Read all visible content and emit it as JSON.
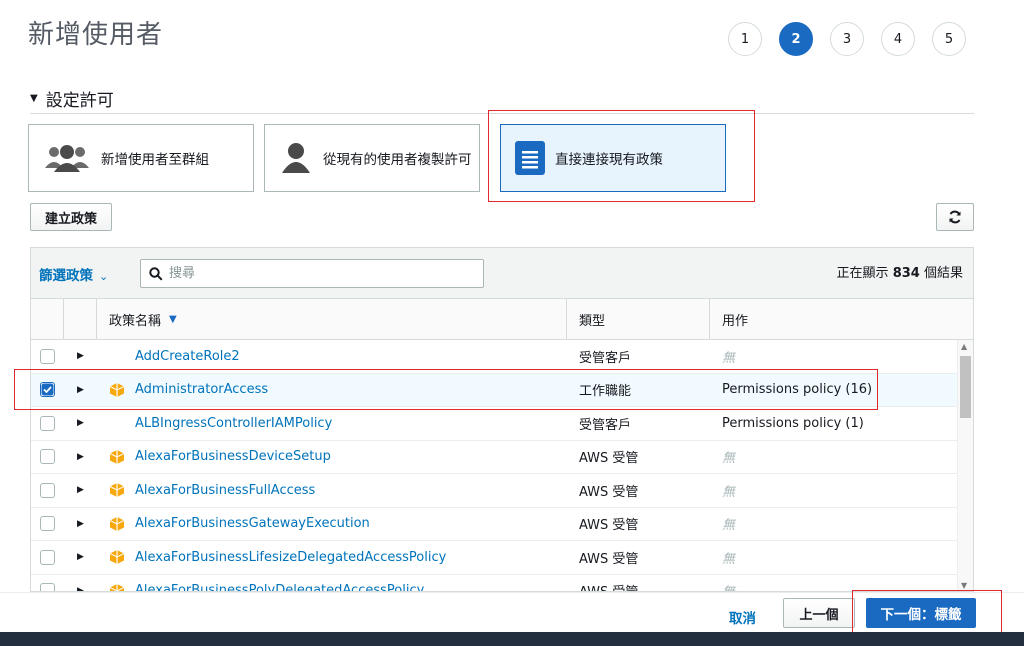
{
  "page": {
    "title": "新增使用者"
  },
  "steps": [
    "1",
    "2",
    "3",
    "4",
    "5"
  ],
  "active_step": "2",
  "section": {
    "title": "設定許可"
  },
  "options": [
    {
      "label": "新增使用者至群組",
      "icon": "users-group-icon"
    },
    {
      "label": "從現有的使用者複製許可",
      "icon": "user-icon"
    },
    {
      "label": "直接連接現有政策",
      "icon": "document-icon"
    }
  ],
  "buttons": {
    "create_policy": "建立政策",
    "refresh": "refresh-icon"
  },
  "table": {
    "filter_label": "篩選政策",
    "search_placeholder": "搜尋",
    "result_prefix": "正在顯示",
    "result_count": "834",
    "result_suffix": "個結果",
    "columns": {
      "name": "政策名稱",
      "type": "類型",
      "use": "用作"
    },
    "rows": [
      {
        "name": "AddCreateRole2",
        "type": "受管客戶",
        "use": "無",
        "aws_icon": false,
        "checked": false
      },
      {
        "name": "AdministratorAccess",
        "type": "工作職能",
        "use": "Permissions policy (16)",
        "aws_icon": true,
        "checked": true
      },
      {
        "name": "ALBIngressControllerIAMPolicy",
        "type": "受管客戶",
        "use": "Permissions policy (1)",
        "aws_icon": false,
        "checked": false
      },
      {
        "name": "AlexaForBusinessDeviceSetup",
        "type": "AWS 受管",
        "use": "無",
        "aws_icon": true,
        "checked": false
      },
      {
        "name": "AlexaForBusinessFullAccess",
        "type": "AWS 受管",
        "use": "無",
        "aws_icon": true,
        "checked": false
      },
      {
        "name": "AlexaForBusinessGatewayExecution",
        "type": "AWS 受管",
        "use": "無",
        "aws_icon": true,
        "checked": false
      },
      {
        "name": "AlexaForBusinessLifesizeDelegatedAccessPolicy",
        "type": "AWS 受管",
        "use": "無",
        "aws_icon": true,
        "checked": false
      },
      {
        "name": "AlexaForBusinessPolyDelegatedAccessPolicy",
        "type": "AWS 受管",
        "use": "無",
        "aws_icon": true,
        "checked": false
      }
    ]
  },
  "footer": {
    "cancel": "取消",
    "previous": "上一個",
    "next": "下一個：標籤"
  },
  "colors": {
    "accent": "#1b6ac2",
    "link": "#0073bb",
    "aws_icon": "#f7a80d",
    "highlight": "#e0282e"
  }
}
